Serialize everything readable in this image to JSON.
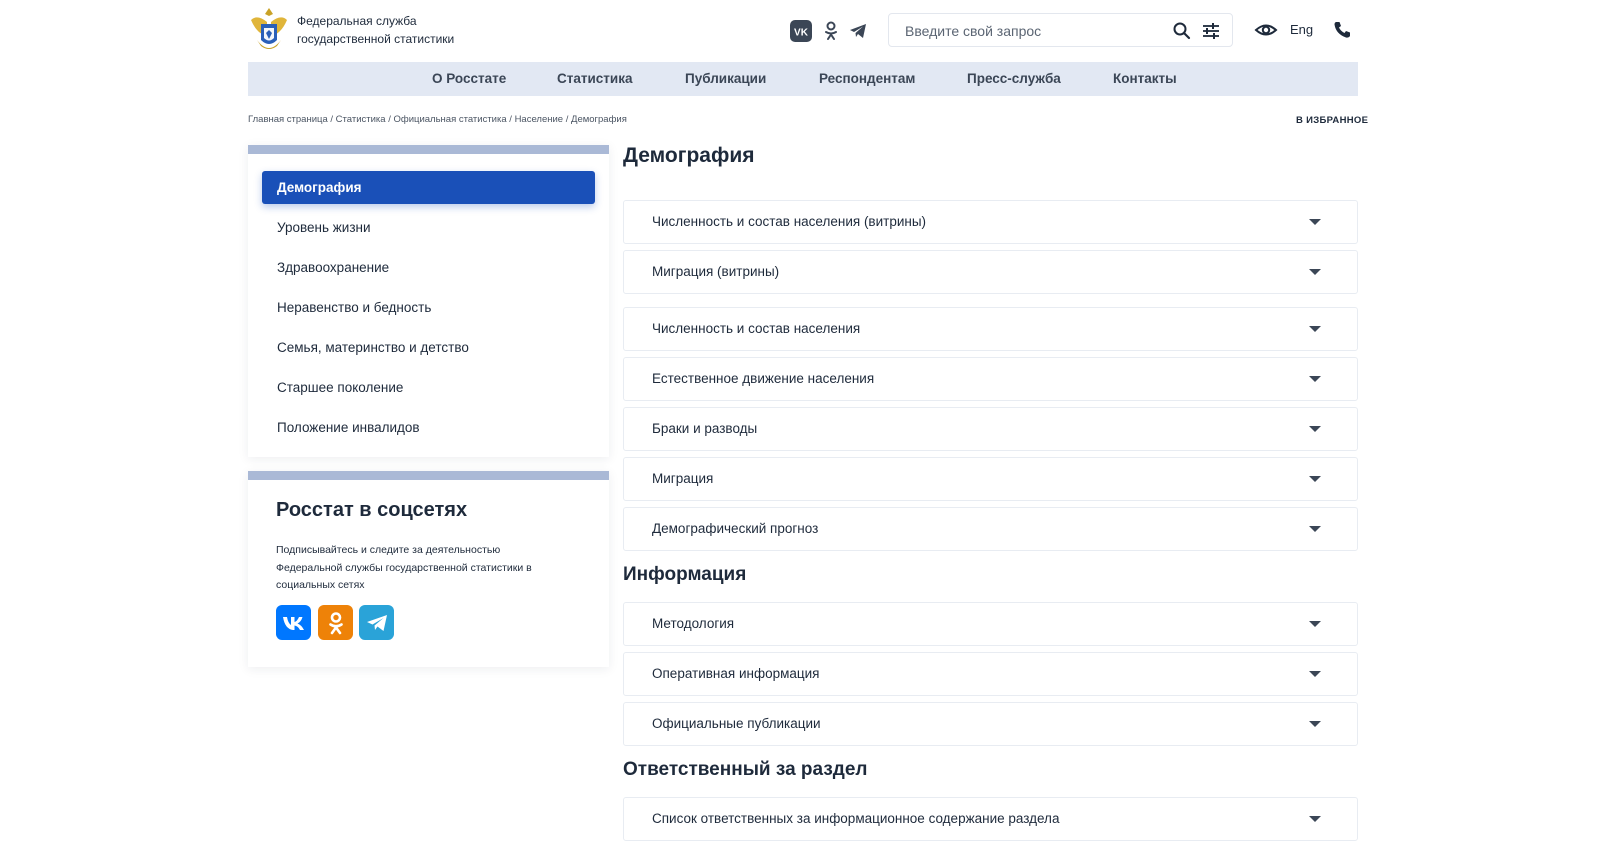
{
  "header": {
    "org_line1": "Федеральная служба",
    "org_line2": "государственной статистики",
    "search_placeholder": "Введите свой запрос",
    "lang_label": "Eng",
    "social_icons": [
      "vk-icon",
      "ok-icon",
      "telegram-icon"
    ]
  },
  "nav": {
    "items": [
      "О Росстате",
      "Статистика",
      "Публикации",
      "Респондентам",
      "Пресс-служба",
      "Контакты"
    ]
  },
  "breadcrumb": {
    "items": [
      "Главная страница",
      "Статистика",
      "Официальная статистика",
      "Население",
      "Демография"
    ],
    "favorite_label": "В ИЗБРАННОЕ"
  },
  "sidebar": {
    "items": [
      "Демография",
      "Уровень жизни",
      "Здравоохранение",
      "Неравенство и бедность",
      "Семья, материнство и детство",
      "Старшее поколение",
      "Положение инвалидов"
    ],
    "active_index": 0,
    "social": {
      "title": "Росстат в соцсетях",
      "description": "Подписывайтесь и следите за деятельностью Федеральной службы государственной статистики в социальных сетях"
    }
  },
  "main": {
    "title": "Демография",
    "group1": [
      "Численность и состав населения (витрины)",
      "Миграция (витрины)"
    ],
    "group2": [
      "Численность и состав населения",
      "Естественное движение населения",
      "Браки и разводы",
      "Миграция",
      "Демографический прогноз"
    ],
    "info_title": "Информация",
    "info_items": [
      "Методология",
      "Оперативная информация",
      "Официальные публикации"
    ],
    "resp_title": "Ответственный за раздел",
    "resp_items": [
      "Список ответственных за информационное содержание раздела"
    ]
  },
  "colors": {
    "accent": "#1a50b8",
    "nav_bg": "#e2e8f3",
    "card_bar": "#aab9d6",
    "vk": "#0077ff",
    "ok": "#ee8208",
    "telegram": "#2aa3d8"
  }
}
